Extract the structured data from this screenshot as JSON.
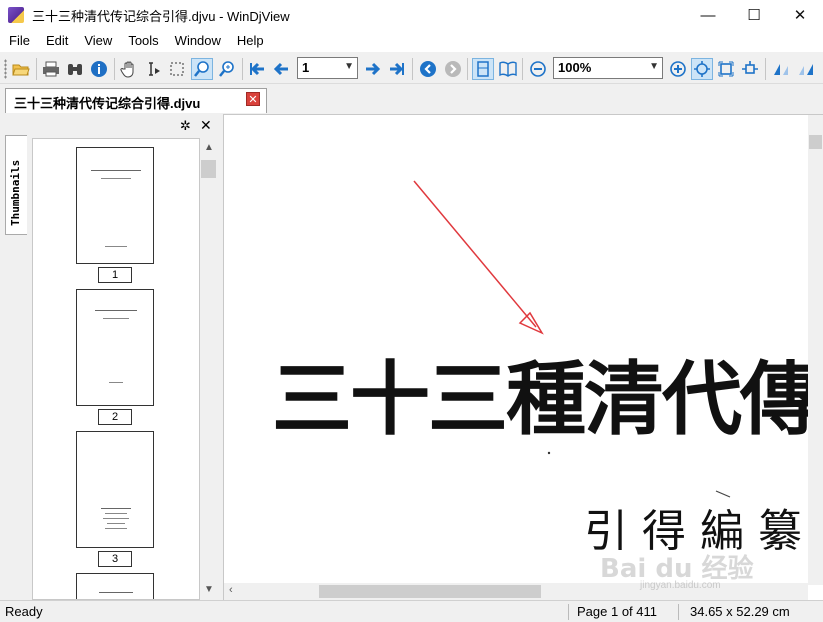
{
  "window": {
    "title": "三十三种清代传记综合引得.djvu - WinDjView",
    "controls": {
      "minimize": "—",
      "maximize": "☐",
      "close": "✕"
    }
  },
  "menu": [
    "File",
    "Edit",
    "View",
    "Tools",
    "Window",
    "Help"
  ],
  "toolbar": {
    "page_input": "1",
    "zoom": "100%",
    "buttons": [
      "open-icon",
      "print-icon",
      "find-icon",
      "info-icon",
      "hand-icon",
      "text-select-icon",
      "rect-select-icon",
      "zoom-rect-icon",
      "zoom-icon",
      "first-page-icon",
      "prev-page-icon",
      "next-page-icon",
      "last-page-icon",
      "back-icon",
      "forward-icon",
      "single-page-icon",
      "facing-pages-icon",
      "zoom-out-icon",
      "zoom-in-icon",
      "fit-page-icon",
      "fit-width-icon",
      "actual-size-icon",
      "rotate-left-icon",
      "rotate-right-icon"
    ]
  },
  "tab": {
    "label": "三十三种清代传记综合引得.djvu",
    "close": "✕"
  },
  "sidebar": {
    "tab_label": "Thumbnails",
    "thumbnails": [
      {
        "number": "1"
      },
      {
        "number": "2"
      },
      {
        "number": "3"
      },
      {
        "number": ""
      }
    ]
  },
  "document": {
    "title_text": "三十三種清代傳",
    "subtitle_text": "引得編纂"
  },
  "status": {
    "ready": "Ready",
    "page": "Page 1 of 411",
    "size": "34.65 x 52.29 cm"
  },
  "watermark": {
    "brand": "Bai du 经验",
    "url": "jingyan.baidu.com"
  },
  "colors": {
    "accent": "#1e73c8",
    "tab_close": "#d9413b",
    "annotation_arrow": "#e0393e"
  }
}
